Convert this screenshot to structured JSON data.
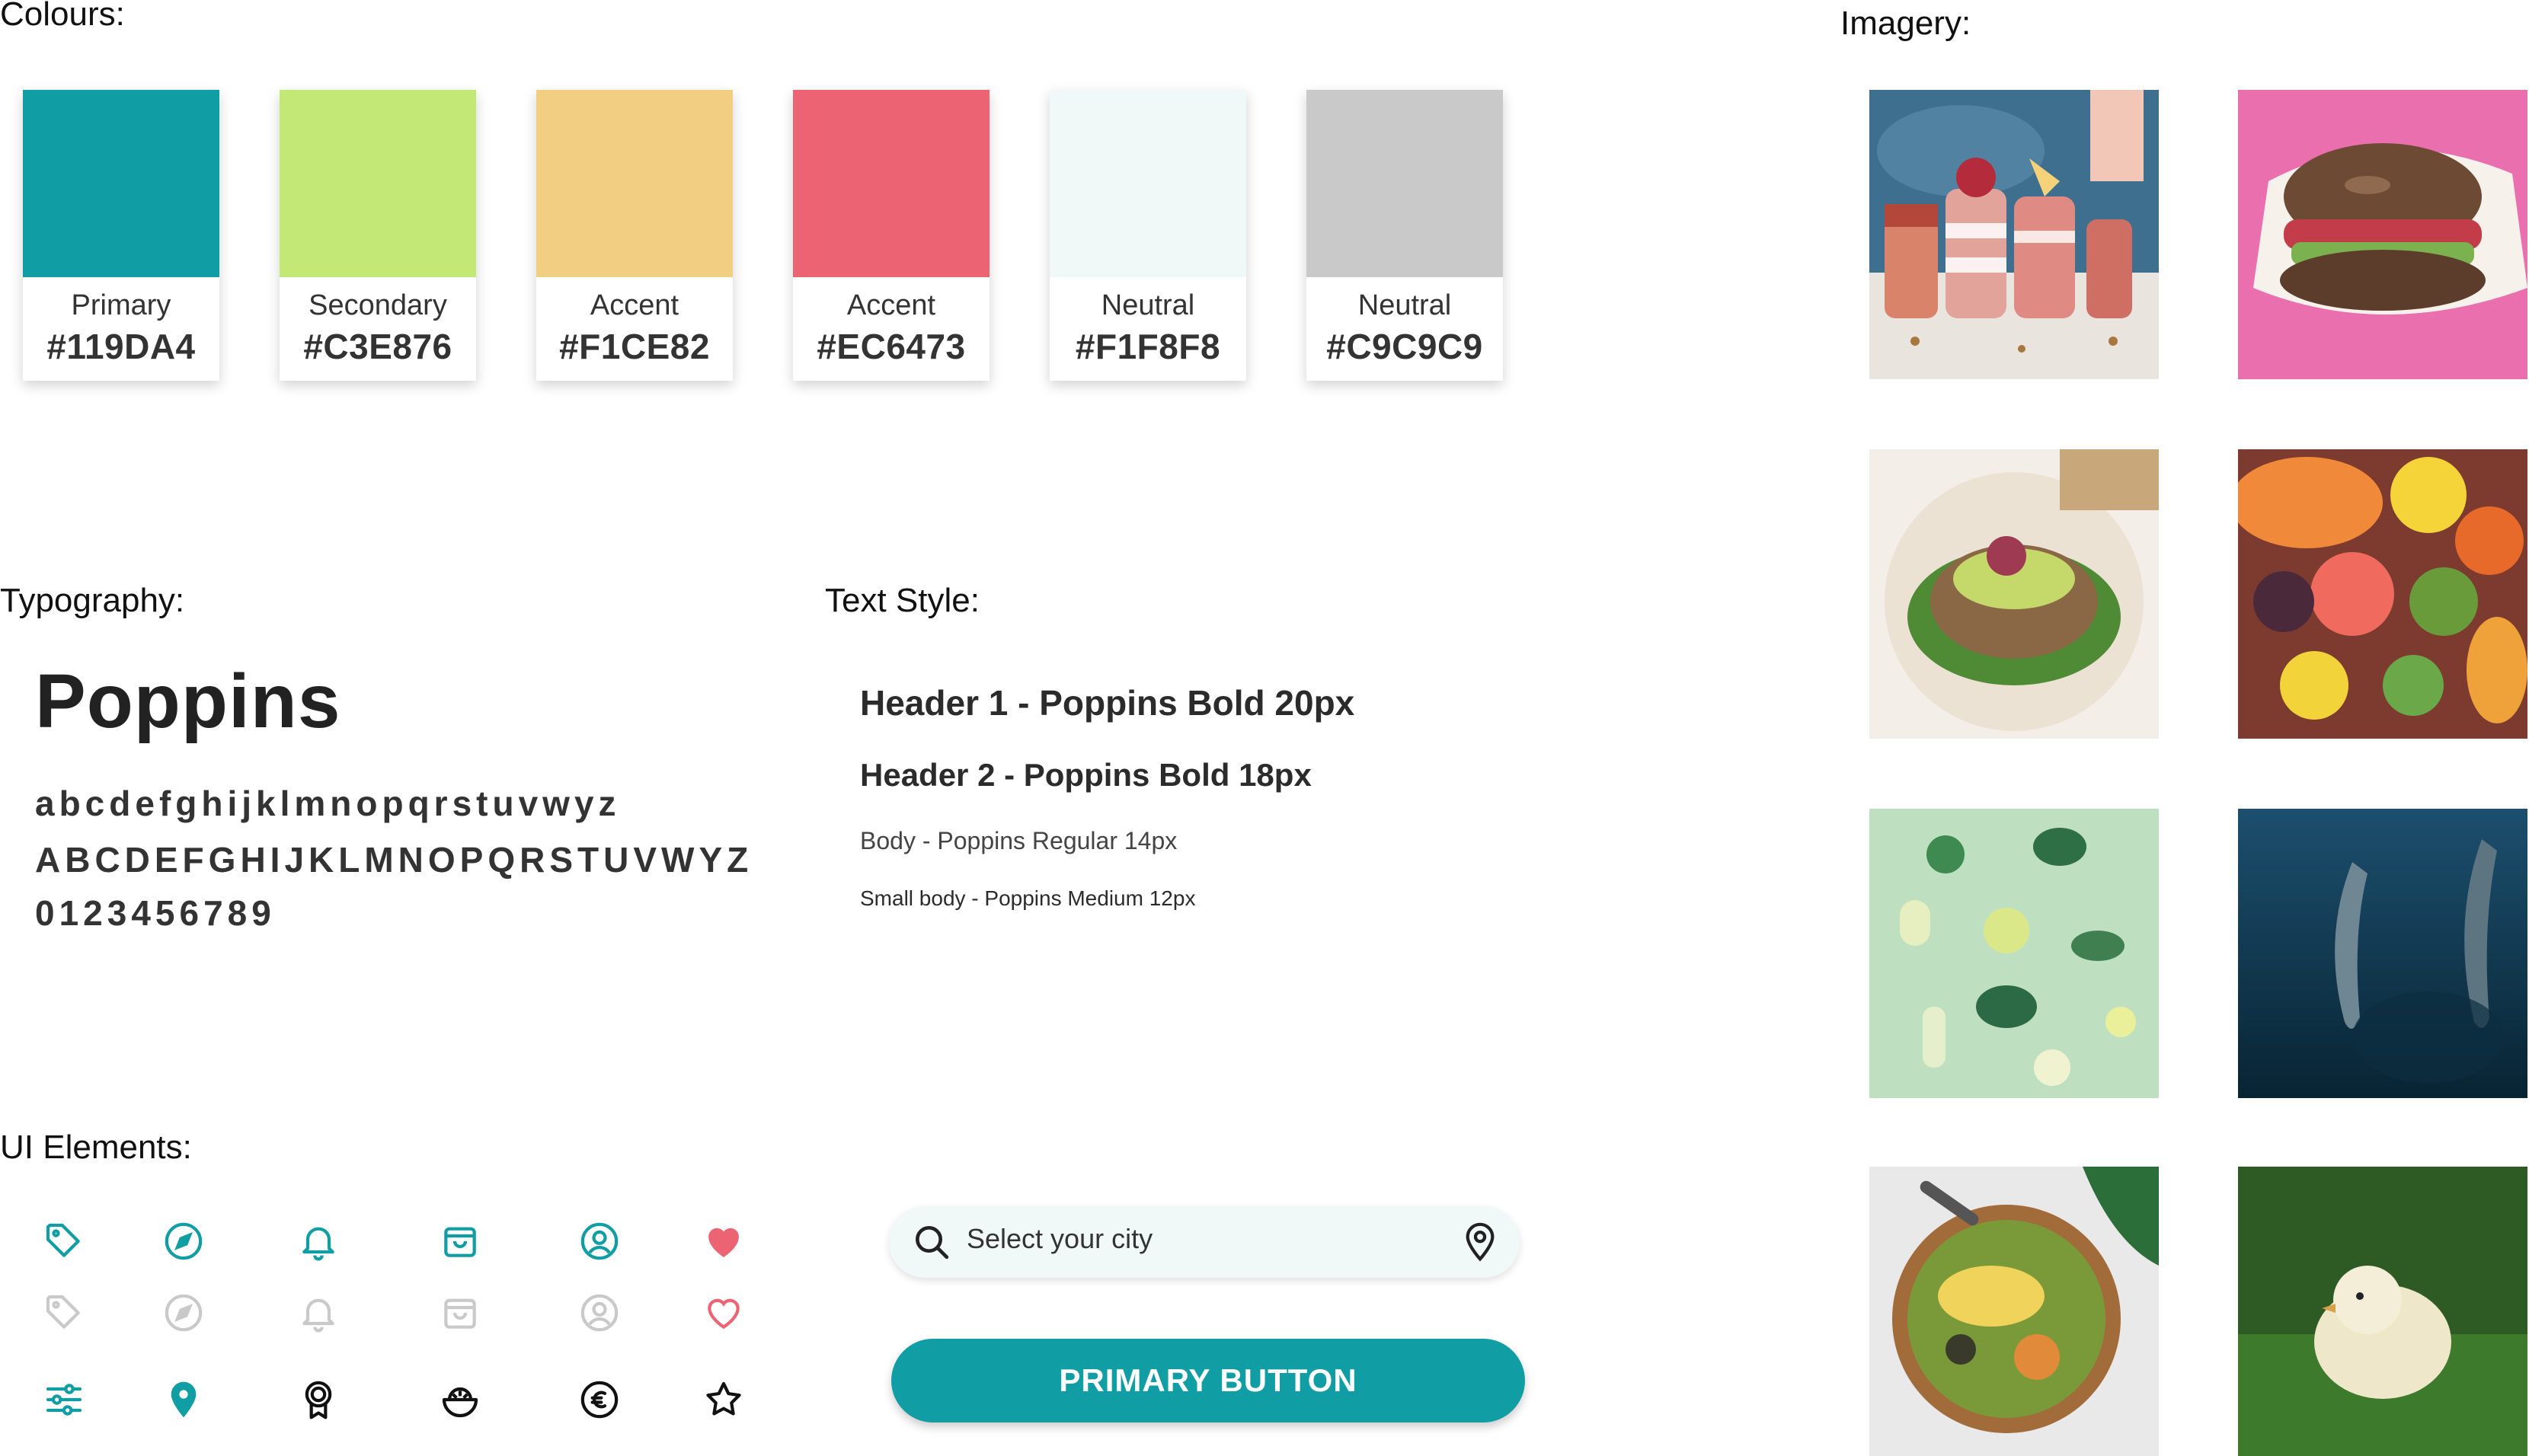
{
  "sections": {
    "colours": "Colours:",
    "imagery": "Imagery:",
    "typography": "Typography:",
    "text_style": "Text Style:",
    "ui_elements": "UI Elements:"
  },
  "colours": [
    {
      "name": "Primary",
      "hex": "#119DA4",
      "color": "#119DA4"
    },
    {
      "name": "Secondary",
      "hex": "#C3E876",
      "color": "#C3E876"
    },
    {
      "name": "Accent",
      "hex": "#F1CE82",
      "color": "#F1CE82"
    },
    {
      "name": "Accent",
      "hex": "#EC6473",
      "color": "#EC6473"
    },
    {
      "name": "Neutral",
      "hex": "#F1F8F8",
      "color": "#F1F8F8"
    },
    {
      "name": "Neutral",
      "hex": "#C9C9C9",
      "color": "#C9C9C9"
    }
  ],
  "typography": {
    "font_name": "Poppins",
    "lowercase": "abcdefghijklmnopqrstuvwyz",
    "uppercase": "ABCDEFGHIJKLMNOPQRSTUVWYZ",
    "digits": "0123456789"
  },
  "text_styles": {
    "h1": "Header 1 - Poppins Bold 20px",
    "h2": "Header 2 - Poppins Bold 18px",
    "body": "Body - Poppins Regular 14px",
    "small": "Small body - Poppins Medium 12px"
  },
  "ui": {
    "search_placeholder": "Select your city",
    "primary_button": "PRIMARY BUTTON",
    "icons_active": [
      "tag-icon",
      "compass-icon",
      "bell-icon",
      "shopping-bag-icon",
      "user-circle-icon",
      "heart-filled-icon"
    ],
    "icons_inactive": [
      "tag-icon",
      "compass-icon",
      "bell-icon",
      "shopping-bag-icon",
      "user-circle-icon",
      "heart-outline-icon"
    ],
    "icons_misc": [
      "filter-sliders-icon",
      "location-pin-icon",
      "award-badge-icon",
      "food-bowl-icon",
      "euro-coin-icon",
      "star-icon"
    ],
    "active_color": "#119DA4",
    "inactive_color": "#C9C9C9",
    "heart_color": "#EC6473"
  },
  "imagery": [
    "smoothies-image",
    "burger-image",
    "avocado-toast-image",
    "fruits-image",
    "greens-flatlay-image",
    "dolphins-image",
    "grain-bowl-image",
    "chick-image"
  ]
}
